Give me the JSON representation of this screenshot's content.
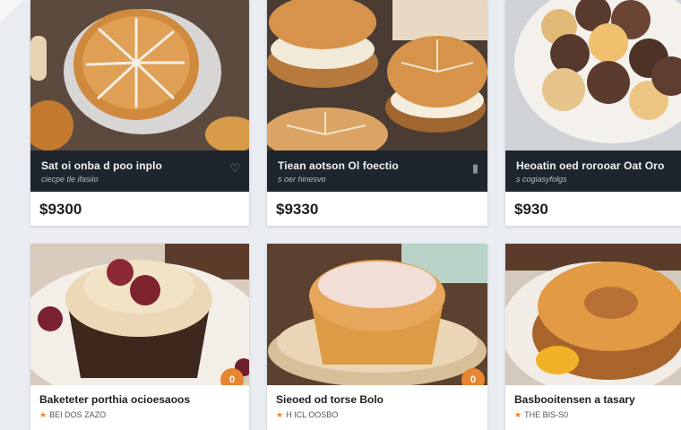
{
  "cards": [
    {
      "title": "Sat oi onba d poo inplo",
      "subtitle": "ciecpe tle ifasiio",
      "price": "$9300",
      "fav_icon": "bookmark-icon"
    },
    {
      "title": "Tiean aotson Ol foectio",
      "subtitle": "s oer hinesvo",
      "price": "$9330",
      "fav_icon": "bookmark-icon"
    },
    {
      "title": "Heoatin oed rorooar Oat Oro",
      "subtitle": "s cogiasyfolgs",
      "price": "$930",
      "fav_icon": ""
    },
    {
      "title": "Baketeter porthia ocioesaoos",
      "subtitle": "BEI DOS ZAZO",
      "badge": "0"
    },
    {
      "title": "Sieoed od torse Bolo",
      "subtitle": "H ICL OOSBO",
      "badge": "0"
    },
    {
      "title": "Basbooitensen a tasary",
      "subtitle": "THE BIS-S0",
      "badge": ""
    }
  ],
  "colors": {
    "accent": "#e8852f",
    "band": "#1f252d",
    "background": "#e9edf2"
  }
}
